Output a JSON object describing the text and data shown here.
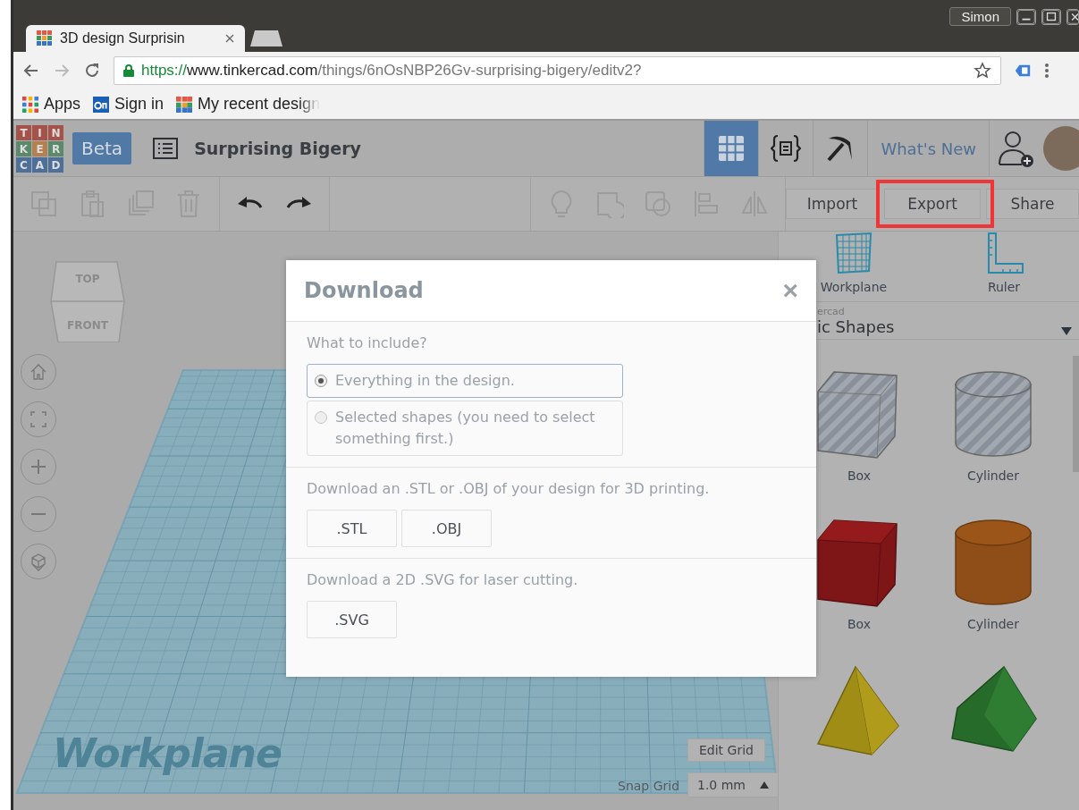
{
  "browser": {
    "profile": "Simon",
    "tabs": [
      {
        "title": "3D design Surprisin",
        "selected": true
      }
    ],
    "url": {
      "scheme": "https://",
      "host": "www.tinkercad.com",
      "path": "/things/6nOsNBP26Gv-surprising-bigery/editv2?"
    },
    "bookmarks": [
      {
        "kind": "apps",
        "label": "Apps"
      },
      {
        "kind": "onshape",
        "label": "Sign in"
      },
      {
        "kind": "tinkercad",
        "label": "My recent design"
      }
    ]
  },
  "app": {
    "logo_letters": [
      "T",
      "I",
      "N",
      "K",
      "E",
      "R",
      "C",
      "A",
      "D"
    ],
    "badge": "Beta",
    "design_title": "Surprising Bigery",
    "views": [
      {
        "kind": "grid",
        "selected": true
      },
      {
        "kind": "code",
        "selected": false
      },
      {
        "kind": "pickaxe",
        "selected": false
      }
    ],
    "whats_new": "What's New",
    "actions": [
      {
        "label": "Import",
        "highlighted": false
      },
      {
        "label": "Export",
        "highlighted": true
      },
      {
        "label": "Share",
        "highlighted": false
      }
    ]
  },
  "view_cube": {
    "top": "TOP",
    "front": "FRONT"
  },
  "canvas": {
    "workplane_label": "Workplane",
    "edit_grid": "Edit Grid",
    "snap_grid_label": "Snap Grid",
    "snap_grid_value": "1.0 mm"
  },
  "panel": {
    "tools": [
      {
        "kind": "workplane",
        "label": "Workplane"
      },
      {
        "kind": "ruler",
        "label": "Ruler"
      }
    ],
    "library_source": "ercad",
    "library_category": "ic Shapes",
    "shapes": [
      {
        "kind": "box-striped",
        "label": "Box"
      },
      {
        "kind": "cylinder-striped",
        "label": "Cylinder"
      },
      {
        "kind": "box",
        "label": "Box"
      },
      {
        "kind": "cylinder",
        "label": "Cylinder"
      },
      {
        "kind": "pyramid"
      },
      {
        "kind": "roof"
      }
    ]
  },
  "dialog": {
    "title": "Download",
    "close": "×",
    "question": "What to include?",
    "options": [
      {
        "label": "Everything in the design.",
        "selected": true
      },
      {
        "label": "Selected shapes (you need to select something first.)",
        "selected": false
      }
    ],
    "sections": [
      {
        "text": "Download an .STL or .OBJ of your design for 3D printing.",
        "buttons": [
          ".STL",
          ".OBJ"
        ]
      },
      {
        "text": "Download a 2D .SVG for laser cutting.",
        "buttons": [
          ".SVG"
        ]
      }
    ]
  }
}
